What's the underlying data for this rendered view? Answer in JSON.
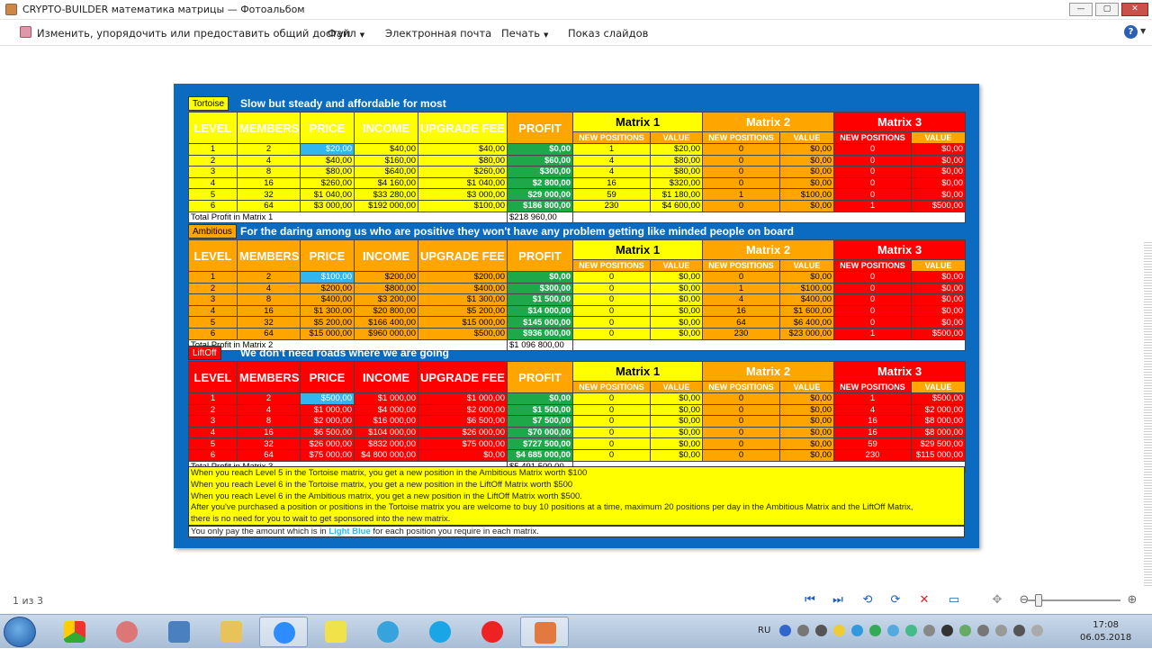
{
  "window": {
    "title": "CRYPTO-BUILDER математика матрицы — Фотоальбом",
    "buttons": [
      "—",
      "▢",
      "✕"
    ]
  },
  "menu": {
    "organize": "Изменить, упорядочить или предоставить общий доступ",
    "file": "Файл",
    "email": "Электронная почта",
    "print": "Печать",
    "slideshow": "Показ слайдов",
    "help": "?"
  },
  "colors": {
    "yellow": "#ffff00",
    "orange": "#ffa500",
    "red": "#ff0000",
    "green": "#1fa84a",
    "lightblue": "#33b5f0",
    "slide_bg": "#0a6bc0"
  },
  "headers": {
    "level": "LEVEL",
    "members": "MEMBERS",
    "price": "PRICE",
    "income": "INCOME",
    "upgrade_fee": "UPGRADE FEE",
    "profit": "PROFIT",
    "matrix1": "Matrix 1",
    "matrix2": "Matrix 2",
    "matrix3": "Matrix 3",
    "new_positions": "NEW POSITIONS",
    "value": "VALUE"
  },
  "tables": [
    {
      "tag": "Tortoise",
      "headline": "Slow but steady and affordable for most",
      "rows": [
        [
          "1",
          "2",
          "$20,00",
          "$40,00",
          "$40,00",
          "$0,00",
          "1",
          "$20,00",
          "0",
          "$0,00",
          "0",
          "$0,00"
        ],
        [
          "2",
          "4",
          "$40,00",
          "$160,00",
          "$80,00",
          "$60,00",
          "4",
          "$80,00",
          "0",
          "$0,00",
          "0",
          "$0,00"
        ],
        [
          "3",
          "8",
          "$80,00",
          "$640,00",
          "$260,00",
          "$300,00",
          "4",
          "$80,00",
          "0",
          "$0,00",
          "0",
          "$0,00"
        ],
        [
          "4",
          "16",
          "$260,00",
          "$4 160,00",
          "$1 040,00",
          "$2 800,00",
          "16",
          "$320,00",
          "0",
          "$0,00",
          "0",
          "$0,00"
        ],
        [
          "5",
          "32",
          "$1 040,00",
          "$33 280,00",
          "$3 000,00",
          "$29 000,00",
          "59",
          "$1 180,00",
          "1",
          "$100,00",
          "0",
          "$0,00"
        ],
        [
          "6",
          "64",
          "$3 000,00",
          "$192 000,00",
          "$100,00",
          "$186 800,00",
          "230",
          "$4 600,00",
          "0",
          "$0,00",
          "1",
          "$500,00"
        ]
      ],
      "total_label": "Total Profit in Matrix 1",
      "total_value": "$218 960,00"
    },
    {
      "tag": "Ambitious",
      "headline": "For the daring among us who are positive they won't have any problem getting like minded people on board",
      "rows": [
        [
          "1",
          "2",
          "$100,00",
          "$200,00",
          "$200,00",
          "$0,00",
          "0",
          "$0,00",
          "0",
          "$0,00",
          "0",
          "$0,00"
        ],
        [
          "2",
          "4",
          "$200,00",
          "$800,00",
          "$400,00",
          "$300,00",
          "0",
          "$0,00",
          "1",
          "$100,00",
          "0",
          "$0,00"
        ],
        [
          "3",
          "8",
          "$400,00",
          "$3 200,00",
          "$1 300,00",
          "$1 500,00",
          "0",
          "$0,00",
          "4",
          "$400,00",
          "0",
          "$0,00"
        ],
        [
          "4",
          "16",
          "$1 300,00",
          "$20 800,00",
          "$5 200,00",
          "$14 000,00",
          "0",
          "$0,00",
          "16",
          "$1 600,00",
          "0",
          "$0,00"
        ],
        [
          "5",
          "32",
          "$5 200,00",
          "$166 400,00",
          "$15 000,00",
          "$145 000,00",
          "0",
          "$0,00",
          "64",
          "$6 400,00",
          "0",
          "$0,00"
        ],
        [
          "6",
          "64",
          "$15 000,00",
          "$960 000,00",
          "$500,00",
          "$936 000,00",
          "0",
          "$0,00",
          "230",
          "$23 000,00",
          "1",
          "$500,00"
        ]
      ],
      "total_label": "Total Profit in Matrix 2",
      "total_value": "$1 096 800,00"
    },
    {
      "tag": "LiftOff",
      "headline": "We don't need roads where we are going",
      "rows": [
        [
          "1",
          "2",
          "$500,00",
          "$1 000,00",
          "$1 000,00",
          "$0,00",
          "0",
          "$0,00",
          "0",
          "$0,00",
          "1",
          "$500,00"
        ],
        [
          "2",
          "4",
          "$1 000,00",
          "$4 000,00",
          "$2 000,00",
          "$1 500,00",
          "0",
          "$0,00",
          "0",
          "$0,00",
          "4",
          "$2 000,00"
        ],
        [
          "3",
          "8",
          "$2 000,00",
          "$16 000,00",
          "$6 500,00",
          "$7 500,00",
          "0",
          "$0,00",
          "0",
          "$0,00",
          "16",
          "$8 000,00"
        ],
        [
          "4",
          "16",
          "$6 500,00",
          "$104 000,00",
          "$26 000,00",
          "$70 000,00",
          "0",
          "$0,00",
          "0",
          "$0,00",
          "16",
          "$8 000,00"
        ],
        [
          "5",
          "32",
          "$26 000,00",
          "$832 000,00",
          "$75 000,00",
          "$727 500,00",
          "0",
          "$0,00",
          "0",
          "$0,00",
          "59",
          "$29 500,00"
        ],
        [
          "6",
          "64",
          "$75 000,00",
          "$4 800 000,00",
          "$0,00",
          "$4 685 000,00",
          "0",
          "$0,00",
          "0",
          "$0,00",
          "230",
          "$115 000,00"
        ]
      ],
      "total_label": "Total Profit in Matrix 3",
      "total_value": "$5 491 500,00"
    }
  ],
  "notes": {
    "line1": "When you reach Level 5 in the Tortoise matrix, you get a new position in the Ambitious Matrix worth $100",
    "line2": "When you reach Level 6 in the Tortoise matrix, you get a new position in the LiftOff Matrix worth $500",
    "line3": "When you reach Level 6 in the Ambitious matrix, you get a new position in the LiftOff Matrix worth $500.",
    "line4": "After you've purchased a position or positions in the Tortoise matrix you are welcome to buy 10 positions at a time, maximum 20 positions per day in the Ambitious Matrix and the LiftOff Matrix,",
    "line5": "there is no need for you to wait to get sponsored into the new matrix.",
    "pay_prefix": "You only pay the amount which is in ",
    "pay_highlight": "Light Blue",
    "pay_suffix": " for each position you require in each matrix."
  },
  "status": {
    "page": "1 из 3"
  },
  "taskbar": {
    "lang": "RU",
    "time": "17:08",
    "date": "06.05.2018"
  }
}
